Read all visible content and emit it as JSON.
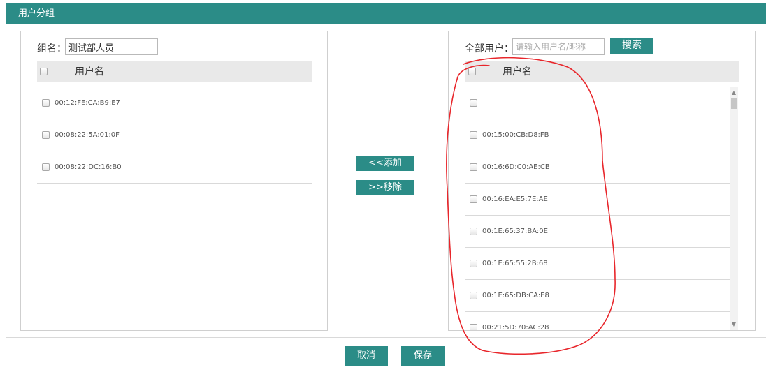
{
  "window": {
    "title": "用户分组"
  },
  "group": {
    "name_label": "组名：",
    "name_value": "测试部人员",
    "header": "用户名",
    "members": [
      "00:12:FE:CA:B9:E7",
      "00:08:22:5A:01:0F",
      "00:08:22:DC:16:B0"
    ]
  },
  "all_users": {
    "label": "全部用户：",
    "search_placeholder": "请输入用户名/昵称",
    "search_button": "搜索",
    "header": "用户名",
    "rows": [
      "",
      "00:15:00:CB:D8:FB",
      "00:16:6D:C0:AE:CB",
      "00:16:EA:E5:7E:AE",
      "00:1E:65:37:BA:0E",
      "00:1E:65:55:2B:68",
      "00:1E:65:DB:CA:E8",
      "00:21:5D:70:AC:28"
    ]
  },
  "transfer": {
    "add": "<<添加",
    "remove": ">>移除"
  },
  "footer": {
    "cancel": "取消",
    "save": "保存"
  },
  "colors": {
    "accent": "#2b8c87",
    "annotation": "#e8262b"
  }
}
